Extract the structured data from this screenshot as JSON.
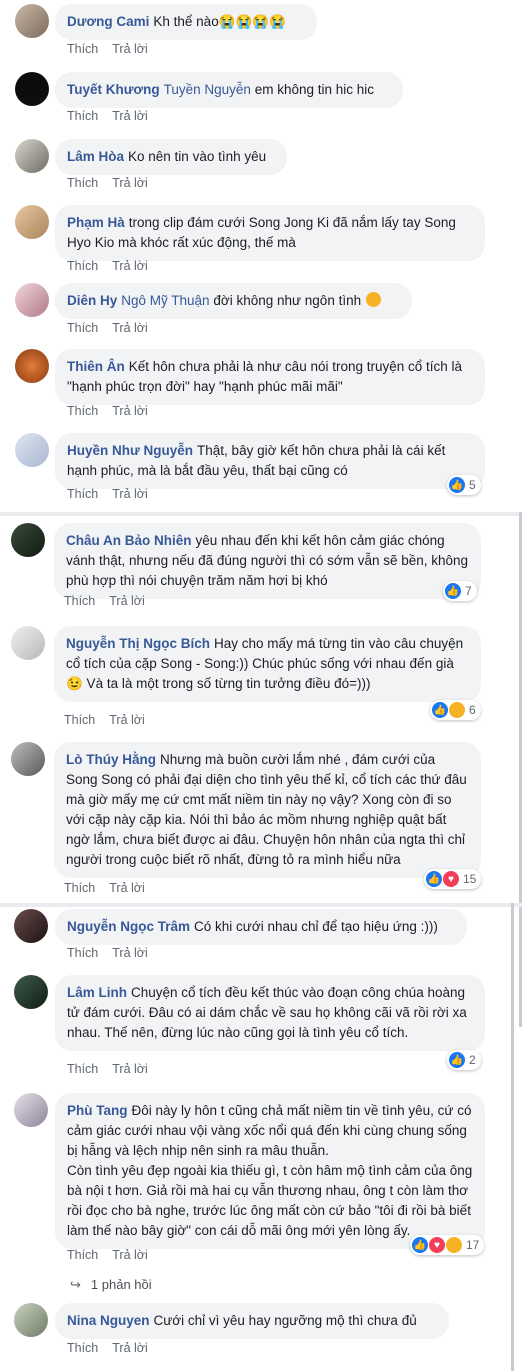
{
  "actions": {
    "like": "Thích",
    "reply": "Trả lời"
  },
  "comments": [
    {
      "name": "Dương Cami",
      "text": "Kh thể nào😭😭😭😭"
    },
    {
      "name": "Tuyết Khương",
      "mention": "Tuyền Nguyễn",
      "text": "em không tin hic hic"
    },
    {
      "name": "Lâm Hòa",
      "text": "Ko nên tin vào tình yêu"
    },
    {
      "name": "Phạm Hà",
      "text": "trong clip đám cưới Song Jong Ki đã nắm lấy tay Song Hyo Kio mà khóc rất xúc động, thế mà"
    },
    {
      "name": "Diên Hy",
      "mention": "Ngô Mỹ Thuận",
      "text": "đời không như ngôn tình"
    },
    {
      "name": "Thiên Ân",
      "text": "Kết hôn chưa phải là như câu nói trong truyện cổ tích là \"hạnh phúc trọn đời\" hay \"hạnh phúc mãi mãi\""
    },
    {
      "name": "Huyền Như Nguyễn",
      "text": "Thật, bây giờ kết hôn chưa phải là cái kết hạnh phúc, mà là bắt đầu yêu, thất bại cũng có",
      "reactions": "5"
    },
    {
      "name": "Châu An Bảo Nhiên",
      "text": "yêu nhau đến khi kết hôn cảm giác chóng vánh thật, nhưng nếu đã đúng người thì có sớm vẫn sẽ bền, không phù hợp thì nói chuyện trăm năm hơi bị khó",
      "reactions": "7"
    },
    {
      "name": "Nguyễn Thị Ngọc Bích",
      "text": "Hay cho mấy má từng tin vào câu chuyện cổ tích của cặp Song - Song:)) Chúc phúc sống với nhau đến già😉 Và ta là một trong số từng tin tưởng điều đó=)))",
      "reactions": "6"
    },
    {
      "name": "Lò Thúy Hằng",
      "text": "Nhưng mà buồn cười lắm nhé , đám cưới của Song Song có phải đại diện cho tình yêu thế kỉ, cổ tích các thứ đâu mà giờ mấy mẹ cứ cmt mất niềm tin này nọ vậy? Xong còn đi so với cặp này cặp kia. Nói thì bảo ác mồm nhưng nghiệp quật bất ngờ lắm, chưa biết được ai đâu. Chuyện hôn nhân của ngta thì chỉ người trong cuộc biết rõ nhất, đừng tỏ ra mình hiểu nữa",
      "reactions": "15"
    },
    {
      "name": "Nguyễn Ngọc Trâm",
      "text": "Có khi cưới nhau chỉ để tạo hiệu ứng :)))"
    },
    {
      "name": "Lâm Linh",
      "text": "Chuyện cổ tích đều kết thúc vào đoạn công chúa hoàng tử đám cưới. Đâu có ai dám chắc về sau họ không cãi vã rồi rời xa nhau. Thế nên, đừng lúc nào cũng gọi là tình yêu cổ tích.",
      "reactions": "2"
    },
    {
      "name": "Phù Tang",
      "text": "Đôi này ly hôn t cũng chả mất niềm tin về tình yêu, cứ có cảm giác cưới nhau vội vàng xốc nổi quá đến khi cùng chung sống bị hẫng và lệch nhịp nên sinh ra mâu thuẫn.",
      "text2": "Còn tình yêu đẹp ngoài kia thiếu gì, t còn hâm mộ tình cảm của ông bà nội t hơn. Giả rồi mà hai cụ vẫn thương nhau, ông t còn làm thơ rồi đọc cho bà nghe, trước lúc ông mất còn cứ bảo \"tôi đi rồi bà biết làm thế nào bây giờ\" con cái dỗ mãi ông mới yên lòng ấy.",
      "reactions": "17"
    },
    {
      "name": "Nina Nguyen",
      "text": "Cưới chỉ vì yêu hay ngưỡng mộ thì chưa đủ"
    }
  ],
  "replies_link": "1 phản hồi",
  "colors": {
    "link": "#385898",
    "bubble": "#f2f3f5",
    "like": "#1877f2",
    "love": "#f33e58",
    "sad": "#f7b125"
  }
}
